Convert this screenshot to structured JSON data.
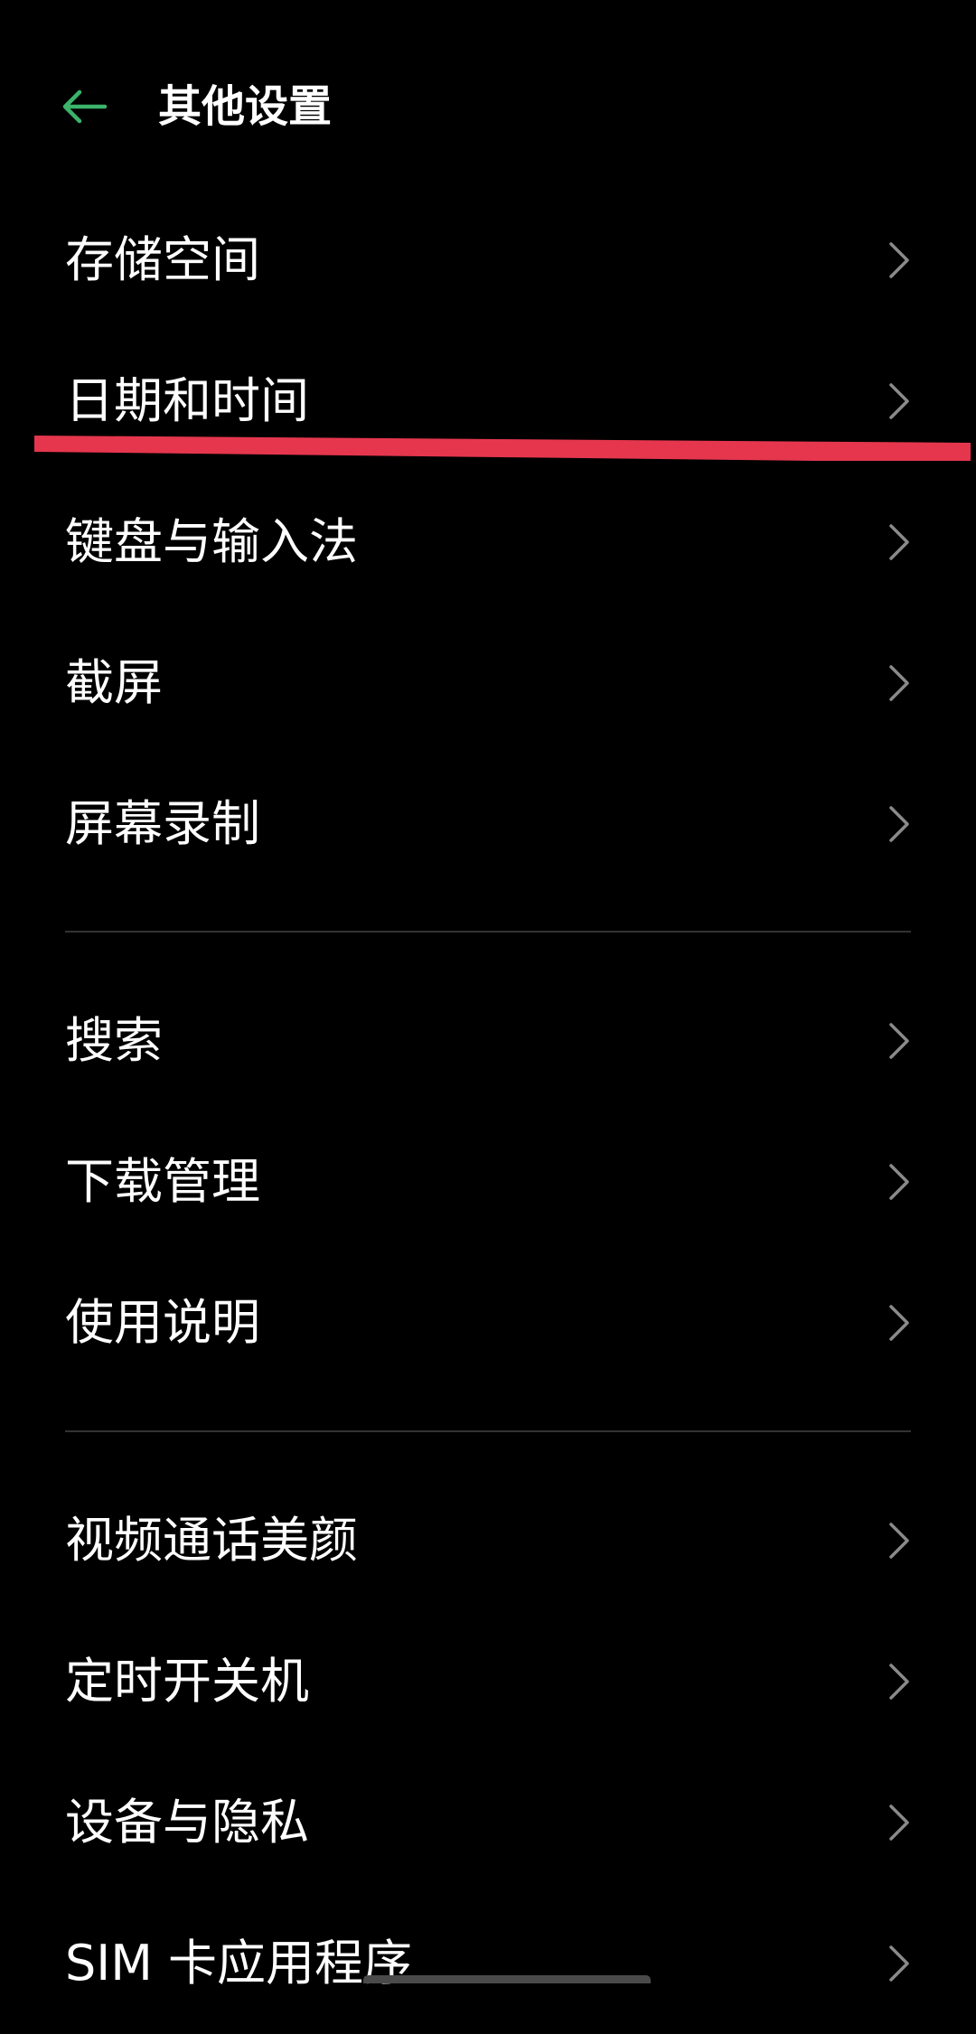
{
  "header": {
    "title": "其他设置"
  },
  "icons": {
    "back": "arrow-left-icon",
    "row_chevron": "chevron-right-icon"
  },
  "colors": {
    "accent": "#3bb36b",
    "annotation": "#e5364d",
    "chevron": "#8a8a8a",
    "divider": "#333333",
    "background": "#000000"
  },
  "groups": [
    {
      "items": [
        {
          "label": "存储空间"
        },
        {
          "label": "日期和时间"
        },
        {
          "label": "键盘与输入法"
        },
        {
          "label": "截屏"
        },
        {
          "label": "屏幕录制"
        }
      ]
    },
    {
      "items": [
        {
          "label": "搜索"
        },
        {
          "label": "下载管理"
        },
        {
          "label": "使用说明"
        }
      ]
    },
    {
      "items": [
        {
          "label": "视频通话美颜"
        },
        {
          "label": "定时开关机"
        },
        {
          "label": "设备与隐私"
        },
        {
          "label": "SIM 卡应用程序"
        }
      ]
    }
  ]
}
